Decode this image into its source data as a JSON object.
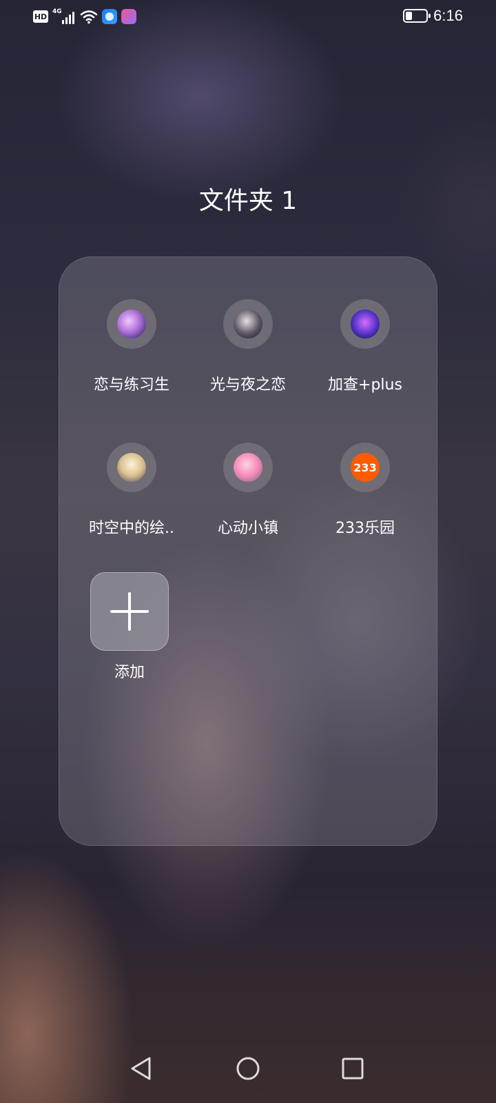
{
  "status_bar": {
    "hd": "HD",
    "network": "4G",
    "time": "6:16",
    "icons": [
      "signal-icon",
      "wifi-icon",
      "browser-app-icon",
      "game-app-icon",
      "battery-icon"
    ]
  },
  "folder": {
    "title": "文件夹 1",
    "apps": [
      {
        "label": "恋与练习生",
        "icon": "avatar-anime-icon"
      },
      {
        "label": "光与夜之恋",
        "icon": "avatar-anime-icon"
      },
      {
        "label": "加查+plus",
        "icon": "gacha-plus-icon"
      },
      {
        "label": "时空中的绘..",
        "icon": "avatar-anime-icon"
      },
      {
        "label": "心动小镇",
        "icon": "avatar-anime-icon"
      },
      {
        "label": "233乐园",
        "icon": "233-icon",
        "icon_text": "233"
      }
    ],
    "add_label": "添加"
  },
  "nav_bar": {
    "icons": [
      "back-icon",
      "home-icon",
      "recents-icon"
    ]
  },
  "colors": {
    "panel": "rgba(200,195,205,0.22)",
    "icon_233": "#ff5a00"
  }
}
